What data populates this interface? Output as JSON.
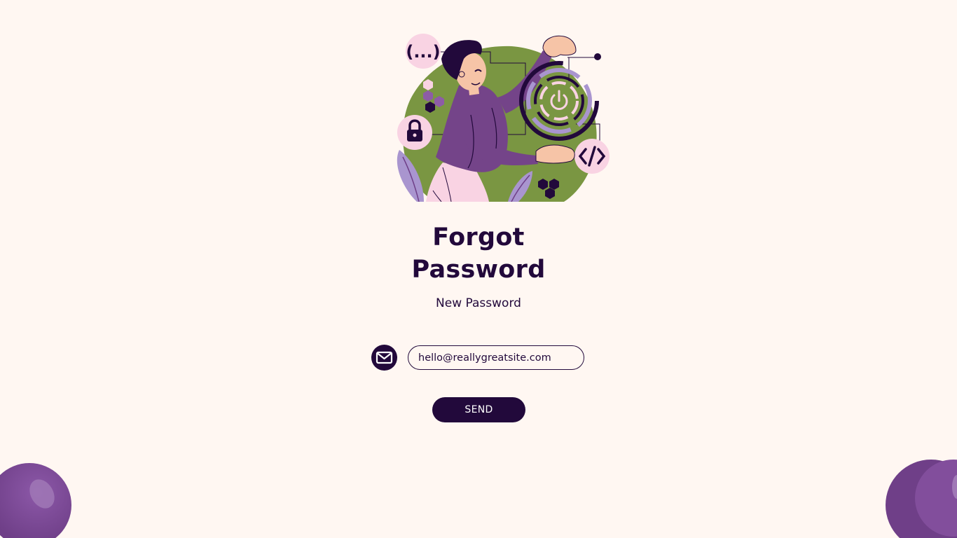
{
  "title": {
    "line1": "Forgot",
    "line2": "Password"
  },
  "subtitle": "New Password",
  "email": {
    "value": "hello@reallygreatsite.com",
    "icon": "mail-icon"
  },
  "send_label": "SEND",
  "colors": {
    "background": "#fff7f2",
    "primary": "#22093b",
    "accent_purple": "#6f3f88",
    "accent_green": "#7a9642",
    "accent_pink": "#f9d3e3"
  }
}
